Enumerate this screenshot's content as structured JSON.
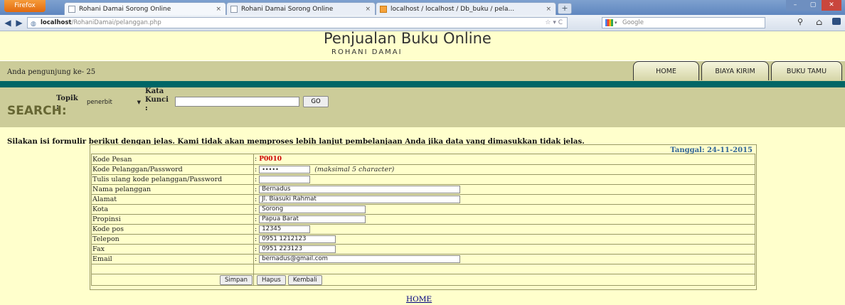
{
  "browser": {
    "app_button": "Firefox",
    "tabs": [
      {
        "title": "Rohani Damai Sorong Online",
        "close": "×"
      },
      {
        "title": "Rohani Damai Sorong Online",
        "close": "×"
      },
      {
        "title": "localhost / localhost / Db_buku / pela...",
        "close": "×"
      }
    ],
    "new_tab": "+",
    "window_controls": {
      "minimize": "–",
      "maximize": "▢",
      "close": "✕"
    },
    "url_host": "localhost",
    "url_path": "/RohaniDamai/pelanggan.php",
    "url_tools": "☆ ▾ C",
    "search_engine": "Google",
    "icons": {
      "back": "back-arrow-icon",
      "forward": "forward-arrow-icon",
      "home": "home-icon",
      "bookmarks": "bookmarks-icon"
    }
  },
  "header": {
    "title": "Penjualan Buku Online",
    "subtitle": "ROHANI DAMAI"
  },
  "visitor_bar": {
    "text": "Anda pengunjung ke- 25"
  },
  "nav": {
    "home": "HOME",
    "biaya_kirim": "BIAYA KIRIM",
    "buku_tamu": "BUKU TAMU"
  },
  "search": {
    "big_label": "SEARCH",
    "colon": ":",
    "topik_label": "Topik",
    "topik_value": "penerbit",
    "kata_label": "Kata",
    "kunci_label": "Kunci",
    "keyword_value": "",
    "go_label": "GO"
  },
  "form": {
    "instructions": "Silakan isi formulir berikut dengan jelas. Kami tidak akan memproses lebih lanjut pembelanjaan Anda jika data yang dimasukkan tidak jelas.",
    "date": "Tanggal: 24-11-2015",
    "rows": [
      {
        "label": "Kode Pesan",
        "value": "P0010"
      },
      {
        "label": "Kode Pelanggan/Password",
        "value": "•••••",
        "hint": "(maksimal 5 character)"
      },
      {
        "label": "Tulis ulang kode pelanggan/Password",
        "value": ""
      },
      {
        "label": "Nama pelanggan",
        "value": "Bernadus"
      },
      {
        "label": "Alamat",
        "value": "Jl. Biasuki Rahmat"
      },
      {
        "label": "Kota",
        "value": "Sorong"
      },
      {
        "label": "Propinsi",
        "value": "Papua Barat"
      },
      {
        "label": "Kode pos",
        "value": "12345"
      },
      {
        "label": "Telepon",
        "value": "0951 1212123"
      },
      {
        "label": "Fax",
        "value": "0951 223123"
      },
      {
        "label": "Email",
        "value": "bernadus@gmail.com"
      }
    ],
    "simpan": "Simpan",
    "hapus": "Hapus",
    "kembali": "Kembali",
    "colon": ":"
  },
  "footer": {
    "home_link": "HOME"
  }
}
